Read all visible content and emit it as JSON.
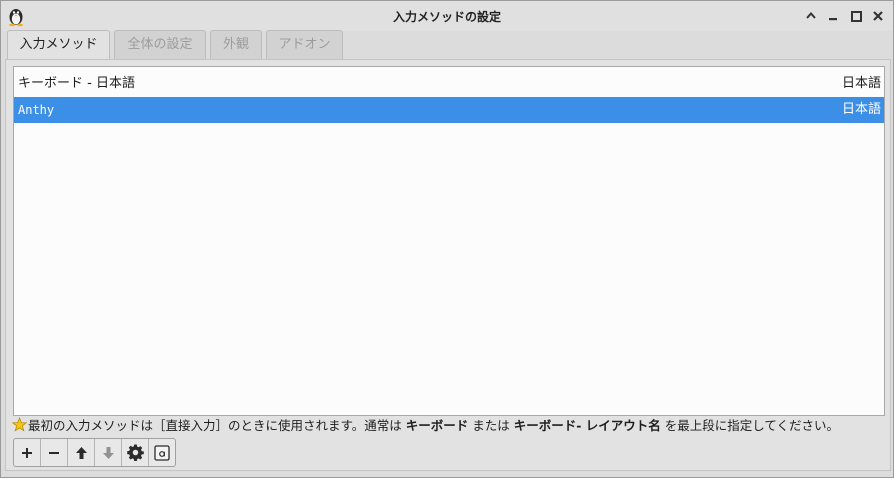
{
  "window": {
    "title": "入力メソッドの設定"
  },
  "tabs": [
    {
      "label": "入力メソッド",
      "active": true
    },
    {
      "label": "全体の設定",
      "active": false
    },
    {
      "label": "外観",
      "active": false
    },
    {
      "label": "アドオン",
      "active": false
    }
  ],
  "input_methods": [
    {
      "name": "キーボード - 日本語",
      "language": "日本語",
      "selected": false
    },
    {
      "name": "Anthy",
      "language": "日本語",
      "selected": true
    }
  ],
  "hint": {
    "icon": "star-icon",
    "part1": "最初の入力メソッドは［直接入力］のときに使用されます。通常は ",
    "bold1": "キーボード",
    "part2": " または ",
    "bold2": "キーボード- レイアウト名",
    "part3": " を最上段に指定してください。"
  },
  "toolbar": [
    {
      "icon": "plus-icon",
      "enabled": true
    },
    {
      "icon": "minus-icon",
      "enabled": true
    },
    {
      "icon": "arrow-up-icon",
      "enabled": true
    },
    {
      "icon": "arrow-down-icon",
      "enabled": false
    },
    {
      "icon": "gear-icon",
      "enabled": true
    },
    {
      "icon": "keyboard-layout-icon",
      "enabled": true
    }
  ],
  "colors": {
    "selection": "#3c8fe6",
    "window_bg": "#dcdcdc",
    "list_bg": "#fcfcfc"
  }
}
